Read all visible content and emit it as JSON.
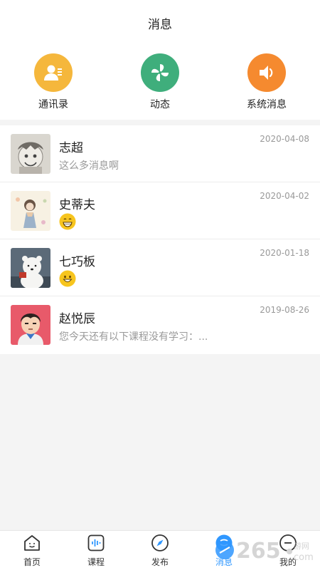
{
  "header": {
    "title": "消息"
  },
  "quick_actions": [
    {
      "label": "通讯录",
      "icon": "contacts-icon",
      "color": "#f5b73c"
    },
    {
      "label": "动态",
      "icon": "pinwheel-icon",
      "color": "#3fae7c"
    },
    {
      "label": "系统消息",
      "icon": "speaker-icon",
      "color": "#f58a2f"
    }
  ],
  "messages": [
    {
      "name": "志超",
      "preview": "这么多消息啊",
      "date": "2020-04-08",
      "avatar": "cartoon-boy-avatar"
    },
    {
      "name": "史蒂夫",
      "preview": "",
      "date": "2020-04-02",
      "avatar": "girl-illustration-avatar",
      "emoji": "grinning-face"
    },
    {
      "name": "七巧板",
      "preview": "",
      "date": "2020-01-18",
      "avatar": "polar-bear-avatar",
      "emoji": "smiling-face"
    },
    {
      "name": "赵悦辰",
      "preview": "您今天还有以下课程没有学习：...",
      "date": "2019-08-26",
      "avatar": "cartoon-man-avatar"
    }
  ],
  "tabbar": {
    "items": [
      {
        "label": "首页",
        "icon": "home-icon",
        "active": false
      },
      {
        "label": "课程",
        "icon": "course-icon",
        "active": false
      },
      {
        "label": "发布",
        "icon": "compass-icon",
        "active": false
      },
      {
        "label": "消息",
        "icon": "message-icon",
        "active": true
      },
      {
        "label": "我的",
        "icon": "profile-icon",
        "active": false
      }
    ]
  },
  "colors": {
    "accent": "#2f97ff",
    "background": "#f4f4f4"
  }
}
